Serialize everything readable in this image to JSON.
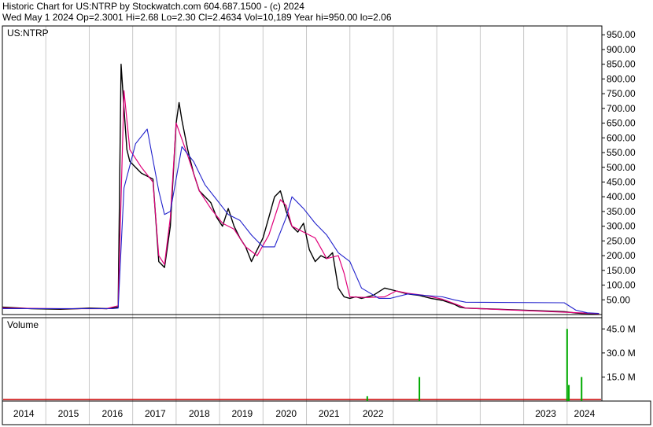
{
  "header": {
    "line1": "Historic Chart for US:NTRP by Stockwatch.com 604.687.1500 - (c) 2024",
    "line2": "Wed May  1 2024  Op=2.3001  Hi=2.68  Lo=2.30  Cl=2.4634  Vol=10,189  Year hi=950.00  lo=2.06"
  },
  "colors": {
    "price": "#000000",
    "ma_short": "#e0007a",
    "ma_long": "#2222cc",
    "volume": "#00aa00",
    "volume_red": "#cc0000",
    "grid": "#c8c8c8"
  },
  "chart_data": [
    {
      "type": "line",
      "title": "US:NTRP",
      "ylim": [
        0,
        980
      ],
      "y_ticks": [
        "50.00",
        "100.00",
        "150.00",
        "200.00",
        "250.00",
        "300.00",
        "350.00",
        "400.00",
        "450.00",
        "500.00",
        "550.00",
        "600.00",
        "650.00",
        "700.00",
        "750.00",
        "800.00",
        "850.00",
        "900.00",
        "950.00"
      ],
      "y_tick_values": [
        50,
        100,
        150,
        200,
        250,
        300,
        350,
        400,
        450,
        500,
        550,
        600,
        650,
        700,
        750,
        800,
        850,
        900,
        950
      ],
      "x_labels": [
        "2014",
        "2015",
        "2016",
        "2017",
        "2018",
        "2019",
        "2020",
        "2021",
        "2022",
        "2023",
        "2024"
      ],
      "series": [
        {
          "key": "price",
          "x": [
            2014.0,
            2014.5,
            2015.0,
            2015.3,
            2015.5,
            2015.8,
            2016.0,
            2016.05,
            2016.1,
            2016.15,
            2016.2,
            2016.3,
            2016.4,
            2016.5,
            2016.6,
            2016.7,
            2016.8,
            2016.9,
            2017.0,
            2017.05,
            2017.1,
            2017.2,
            2017.3,
            2017.4,
            2017.5,
            2017.6,
            2017.7,
            2017.8,
            2017.9,
            2018.0,
            2018.1,
            2018.2,
            2018.3,
            2018.4,
            2018.5,
            2018.6,
            2018.7,
            2018.8,
            2018.9,
            2019.0,
            2019.1,
            2019.2,
            2019.3,
            2019.4,
            2019.5,
            2019.6,
            2019.7,
            2019.8,
            2019.9,
            2020.0,
            2020.1,
            2020.2,
            2020.4,
            2020.6,
            2020.8,
            2020.9,
            2021.0,
            2021.2,
            2021.4,
            2021.6,
            2021.8,
            2021.9,
            2022.0,
            2023.7,
            2023.9,
            2024.0,
            2024.3
          ],
          "y": [
            25,
            20,
            18,
            20,
            22,
            20,
            25,
            850,
            700,
            560,
            520,
            500,
            480,
            470,
            460,
            180,
            160,
            300,
            650,
            720,
            660,
            560,
            480,
            420,
            400,
            380,
            330,
            300,
            360,
            300,
            260,
            230,
            180,
            220,
            260,
            330,
            400,
            420,
            350,
            300,
            280,
            310,
            220,
            180,
            200,
            190,
            210,
            90,
            60,
            55,
            60,
            55,
            65,
            90,
            80,
            75,
            70,
            65,
            55,
            48,
            35,
            25,
            22,
            10,
            5,
            4,
            3
          ]
        },
        {
          "key": "ma_short",
          "x": [
            2014.0,
            2015.0,
            2015.8,
            2016.0,
            2016.1,
            2016.2,
            2016.4,
            2016.6,
            2016.7,
            2016.8,
            2016.9,
            2017.0,
            2017.2,
            2017.4,
            2017.6,
            2017.8,
            2018.0,
            2018.2,
            2018.4,
            2018.6,
            2018.8,
            2018.9,
            2019.0,
            2019.2,
            2019.4,
            2019.6,
            2019.8,
            2019.9,
            2020.0,
            2020.3,
            2020.6,
            2020.8,
            2021.0,
            2021.3,
            2021.6,
            2021.9,
            2022.0,
            2023.7,
            2024.3
          ],
          "y": [
            22,
            20,
            20,
            30,
            760,
            560,
            500,
            450,
            200,
            170,
            330,
            650,
            540,
            420,
            360,
            310,
            290,
            230,
            200,
            270,
            390,
            370,
            300,
            280,
            260,
            190,
            200,
            140,
            60,
            58,
            60,
            80,
            72,
            65,
            52,
            30,
            22,
            8,
            3
          ]
        },
        {
          "key": "ma_long",
          "x": [
            2014.0,
            2015.0,
            2015.9,
            2016.0,
            2016.1,
            2016.3,
            2016.5,
            2016.7,
            2016.8,
            2016.9,
            2017.1,
            2017.3,
            2017.5,
            2017.7,
            2017.9,
            2018.1,
            2018.3,
            2018.5,
            2018.7,
            2018.9,
            2019.0,
            2019.2,
            2019.4,
            2019.6,
            2019.8,
            2020.0,
            2020.2,
            2020.5,
            2020.7,
            2021.0,
            2021.3,
            2021.6,
            2021.8,
            2022.0,
            2023.7,
            2023.9,
            2024.1,
            2024.3
          ],
          "y": [
            20,
            20,
            20,
            22,
            430,
            580,
            630,
            420,
            340,
            350,
            570,
            520,
            440,
            390,
            340,
            320,
            270,
            230,
            230,
            330,
            400,
            360,
            310,
            270,
            210,
            180,
            90,
            55,
            55,
            70,
            65,
            60,
            50,
            42,
            40,
            15,
            6,
            4
          ]
        }
      ]
    },
    {
      "type": "bar",
      "title": "Volume",
      "ylim": [
        0,
        52
      ],
      "y_ticks": [
        "15.0 M",
        "30.0 M",
        "45.0 M"
      ],
      "y_tick_values": [
        15,
        30,
        45
      ],
      "x": [
        2020.3,
        2021.2,
        2023.75,
        2023.78,
        2024.0
      ],
      "values": [
        3,
        15,
        45,
        10,
        15
      ]
    }
  ]
}
